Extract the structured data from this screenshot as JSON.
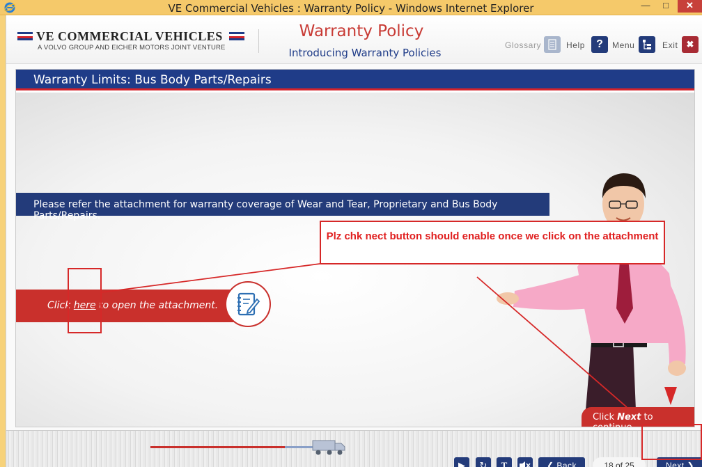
{
  "window": {
    "title": "VE Commercial Vehicles : Warranty Policy - Windows Internet Explorer",
    "minimize": "—",
    "maximize": "□",
    "close": "✕"
  },
  "header": {
    "brand_name": "VE COMMERCIAL VEHICLES",
    "brand_tagline": "A VOLVO GROUP AND EICHER MOTORS JOINT VENTURE",
    "course_title": "Warranty Policy",
    "course_subtitle": "Introducing Warranty Policies",
    "tools": {
      "glossary": "Glossary",
      "help": "Help",
      "menu": "Menu",
      "exit": "Exit"
    }
  },
  "content": {
    "section_title": "Warranty Limits: Bus Body Parts/Repairs",
    "info_text": "Please refer the attachment for warranty coverage of Wear and Tear, Proprietary and Bus Body Parts/Repairs.",
    "click_prefix": "Click ",
    "click_link": "here",
    "click_suffix": " to open the attachment.",
    "continue_prefix": "Click ",
    "continue_bold": "Next",
    "continue_suffix": " to continue."
  },
  "annotation": {
    "note": "Plz chk nect button should enable once we click on the attachment",
    "color": "#d62828"
  },
  "footer": {
    "progress": 0.72,
    "back_label": "Back",
    "next_label": "Next",
    "text_label": "T",
    "page_indicator": "18 of 25"
  },
  "colors": {
    "brand_blue": "#1f3c88",
    "brand_red": "#c9302c"
  }
}
